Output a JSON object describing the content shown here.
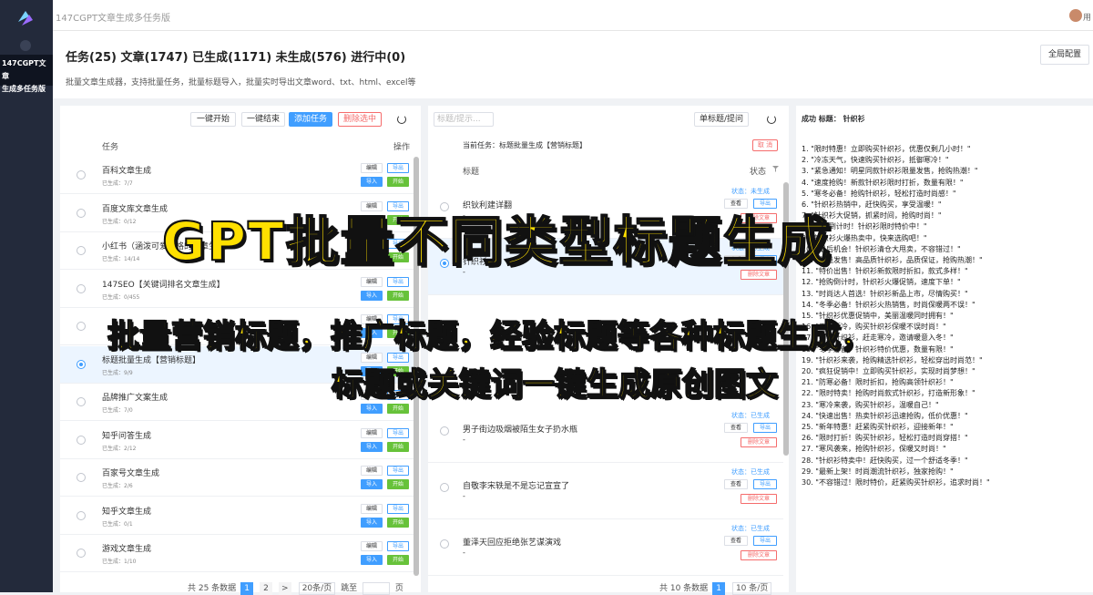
{
  "app": {
    "title": "147CGPT文章生成多任务版",
    "side_label_1": "147CGPT文章",
    "side_label_2": "生成多任务版",
    "user_initial": "用"
  },
  "header": {
    "stats": "任务(25) 文章(1747) 已生成(1171) 未生成(576) 进行中(0)",
    "desc": "批量文章生成器，支持批量任务，批量标题导入，批量实时导出文章word、txt、html、excel等",
    "global_config": "全局配置"
  },
  "task_panel": {
    "buttons": {
      "start_all": "一键开始",
      "stop_all": "一键结束",
      "add_task": "添加任务",
      "delete_selected": "删除选中"
    },
    "col_task": "任务",
    "col_action": "操作",
    "row_buttons": {
      "edit": "编辑",
      "export": "导出",
      "import": "导入",
      "start": "开始"
    },
    "tasks": [
      {
        "name": "百科文章生成",
        "sub": "已生成：7/7"
      },
      {
        "name": "百度文库文章生成",
        "sub": "已生成：0/12"
      },
      {
        "name": "小红书（涵泼可爱风格的文章生成）",
        "sub": "已生成：14/14"
      },
      {
        "name": "147SEO【关键词排名文章生成】",
        "sub": "已生成：0/455"
      },
      {
        "name": "",
        "sub": ""
      },
      {
        "name": "标题批量生成【营销标题】",
        "sub": "已生成：9/9"
      },
      {
        "name": "品牌推广文案生成",
        "sub": "已生成：7/0"
      },
      {
        "name": "知乎问答生成",
        "sub": "已生成：2/12"
      },
      {
        "name": "百家号文章生成",
        "sub": "已生成：2/6"
      },
      {
        "name": "知乎文章生成",
        "sub": "已生成：0/1"
      },
      {
        "name": "游戏文章生成",
        "sub": "已生成：1/10"
      }
    ],
    "pager": {
      "total": "共 25 条数据",
      "page1": "1",
      "page2": "2",
      "next": ">",
      "size": "20条/页",
      "goto": "跳至",
      "page_unit": "页"
    }
  },
  "title_panel": {
    "search_placeholder": "标题/提示...",
    "single_btn": "单标题/提问",
    "current_task": "当前任务：标题批量生成【营销标题】",
    "cancel": "取 消",
    "col_title": "标题",
    "col_state": "状态",
    "state_label": "状态：未生成",
    "state_done": "状态：已生成",
    "btns": {
      "view": "查看",
      "export": "导出",
      "delete": "删除文章"
    },
    "rows": [
      {
        "title": "织钬利建详翻",
        "sub": "-"
      },
      {
        "title": "针织衫",
        "sub": "-"
      },
      {
        "title": "男子街边吸烟被陌生女子扔水瓶",
        "sub": "-"
      },
      {
        "title": "自敬李宋轶是不是忘记宣宣了",
        "sub": "-"
      },
      {
        "title": "董泽天回应拒绝张艺谋演戏",
        "sub": "-"
      }
    ],
    "pager": {
      "total": "共 10 条数据",
      "page1": "1",
      "size": "10 条/页"
    }
  },
  "result_panel": {
    "heading": "成功 标题：  针织衫",
    "items": [
      "1. \"限时特惠！立即购买针织衫，优惠仅剩几小时！\"",
      "2. \"冷冻天气，快速购买针织衫，抵御寒冷！\"",
      "3. \"紧急通知！明星同款针织衫限量发售，抢购热潮！\"",
      "4. \"速度抢购！新款针织衫限时打折，数量有限！\"",
      "5. \"寒冬必备！抢购针织衫，轻松打造时尚感！\"",
      "6. \"针织衫热销中，赶快购买，享受温暖！\"",
      "7. \"针织衫大促销，抓紧时间，抢购时尚！\"",
      "8. \"抢购倒计时！针织衫限时特价中！\"",
      "9. \"针织衫火爆热卖中，快来选购吧！\"",
      "10. \"最后机会！针织衫清仓大甩卖，不容错过！\"",
      "11. \"限量发售！高品质针织衫，品质保证，抢购热潮！\"",
      "11. \"特价出售！针织衫新款限时折扣，款式多样！\"",
      "12. \"抢购倒计时，针织衫火爆促销，速度下单！\"",
      "13. \"时尚达人首选！针织衫新品上市，尽情购买！\"",
      "14. \"冬季必备！针织衫火热销售，时尚保暖两不误！\"",
      "15. \"针织衫优惠促销中，美丽温暖同时拥有！\"",
      "16. \"天气渐冷，购买针织衫保暖不误时尚！\"",
      "17. \"购买针织衫，赶走寒冷，邀请暖意入冬！\"",
      "18. \"冬季必备，针织衫特价优惠，数量有限！\"",
      "19. \"针织衫来袭，抢购精选针织衫，轻松穿出时尚范！\"",
      "20. \"疯狂促销中！立即购买针织衫，实现时尚梦想！\"",
      "21. \"防寒必备！限时折扣，抢购高领针织衫！\"",
      "22. \"限时特卖！抢购时尚款式针织衫，打造新形象！\"",
      "23. \"寒冷来袭，购买针织衫，温暖自己！\"",
      "24. \"快速出售！热卖针织衫迅速抢购，低价优惠！\"",
      "25. \"新年特惠！赶紧购买针织衫，迎接新年！\"",
      "26. \"限时打折！购买针织衫，轻松打造时尚穿搭！\"",
      "27. \"寒风袭来，抢购针织衫，保暖又时尚！\"",
      "28. \"针织衫特卖中！赶快购买，过一个舒适冬季！\"",
      "29. \"最新上架！时尚潮流针织衫，独家抢购！\"",
      "30. \"不容错过！限时特价，赶紧购买针织衫，追求时尚！\""
    ]
  },
  "overlay": {
    "headline": "GPT批量不同类型标题生成",
    "line1": "批量营销标题，推广标题，经验标题等各种标题生成，",
    "line2": "标题或关键词一键生成原创图文"
  },
  "colors": {
    "primary": "#409eff",
    "success": "#67c23a",
    "danger": "#f56c6c",
    "sidebar": "#232a3b",
    "overlay_text": "#ffe000"
  }
}
